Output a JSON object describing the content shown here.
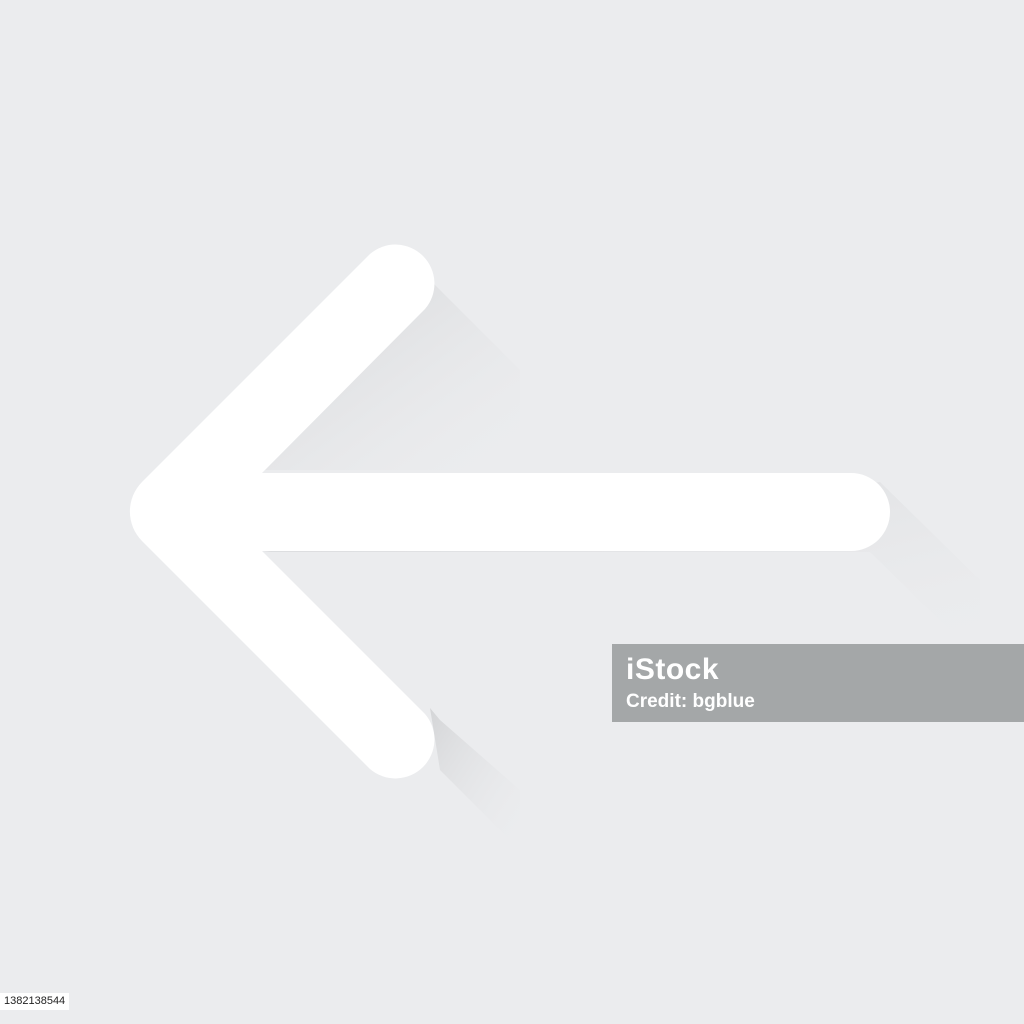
{
  "background_color": "#ebecee",
  "icon": {
    "name": "arrow-left-icon",
    "fill": "#ffffff",
    "shadow_color": "#d3d4d6"
  },
  "watermark": {
    "logo_text": "iStock",
    "credit_text": "Credit: bgblue",
    "background_color": "#a4a7a8"
  },
  "image_id": "1382138544"
}
